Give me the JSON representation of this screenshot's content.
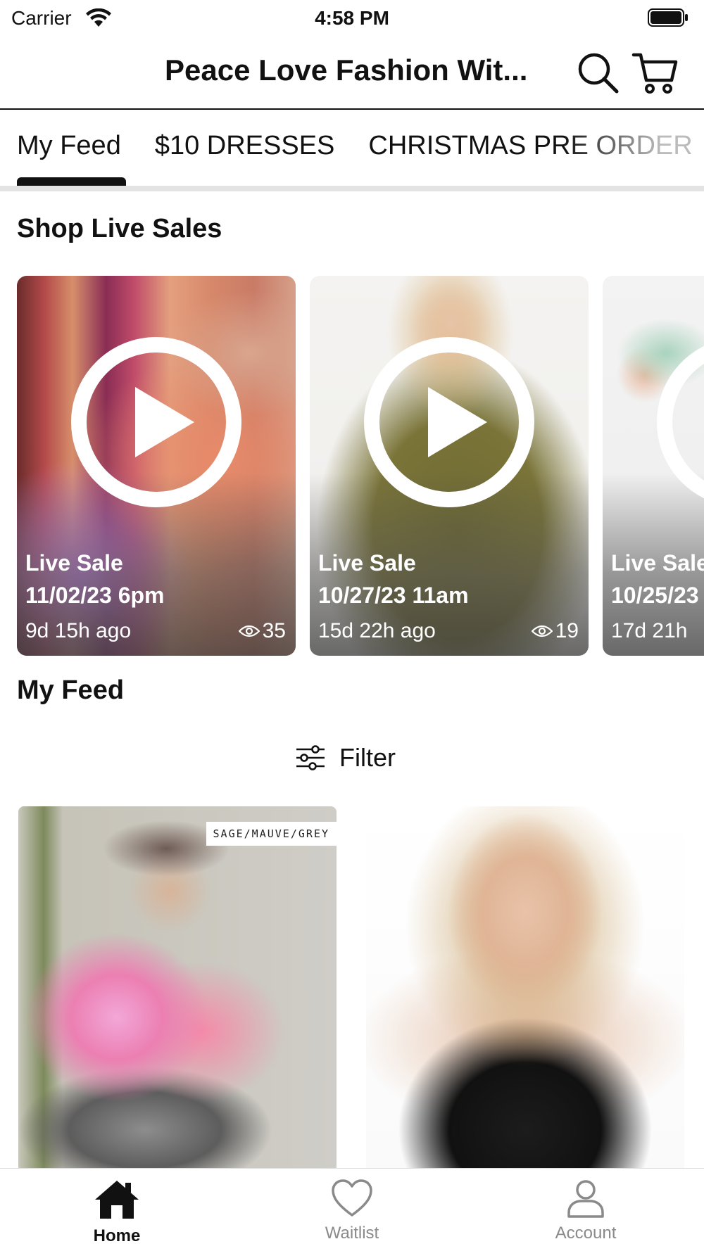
{
  "status_bar": {
    "carrier": "Carrier",
    "time": "4:58 PM"
  },
  "header": {
    "title": "Peace Love Fashion Wit...",
    "search_icon": "search-icon",
    "cart_icon": "cart-icon"
  },
  "tabs": [
    {
      "label": "My Feed",
      "active": true
    },
    {
      "label": "$10 DRESSES",
      "active": false
    },
    {
      "label": "CHRISTMAS PRE ORDER",
      "active": false
    }
  ],
  "live_sales": {
    "title": "Shop Live Sales",
    "cards": [
      {
        "label": "Live Sale",
        "date": "11/02/23 6pm",
        "ago": "9d 15h ago",
        "views": "35"
      },
      {
        "label": "Live Sale",
        "date": "10/27/23 11am",
        "ago": "15d 22h ago",
        "views": "19"
      },
      {
        "label": "Live Sale",
        "date": "10/25/23",
        "ago": "17d 21h",
        "views": ""
      }
    ]
  },
  "feed": {
    "title": "My Feed",
    "filter_label": "Filter",
    "products": [
      {
        "tag": "SAGE/MAUVE/GREY"
      },
      {
        "tag": ""
      }
    ]
  },
  "bottom_nav": [
    {
      "label": "Home",
      "icon": "home-icon",
      "active": true
    },
    {
      "label": "Waitlist",
      "icon": "heart-icon",
      "active": false
    },
    {
      "label": "Account",
      "icon": "user-icon",
      "active": false
    }
  ],
  "colors": {
    "text": "#111111",
    "inactive": "#8a8a8a",
    "divider": "#e3e3e3"
  }
}
